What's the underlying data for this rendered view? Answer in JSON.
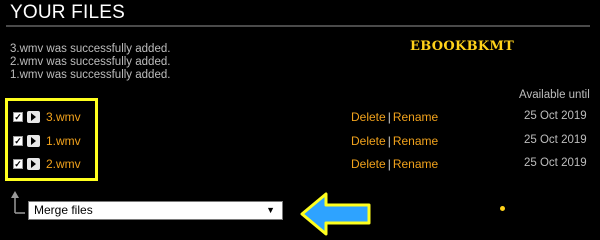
{
  "header": {
    "title": "YOUR FILES"
  },
  "messages": [
    "3.wmv was successfully added.",
    "2.wmv was successfully added.",
    "1.wmv was successfully added."
  ],
  "watermark": "EBOOKBKMT",
  "table": {
    "column_header": "Available until",
    "rows": [
      {
        "name": "3.wmv",
        "delete": "Delete",
        "separator": "|",
        "rename": "Rename",
        "expiry": "25 Oct 2019",
        "checked": true
      },
      {
        "name": "1.wmv",
        "delete": "Delete",
        "separator": "|",
        "rename": "Rename",
        "expiry": "25 Oct 2019",
        "checked": true
      },
      {
        "name": "2.wmv",
        "delete": "Delete",
        "separator": "|",
        "rename": "Rename",
        "expiry": "25 Oct 2019",
        "checked": true
      }
    ]
  },
  "action_select": {
    "selected": "Merge files",
    "caret": "▼"
  },
  "icons": {
    "checkbox": "checkbox-checked-icon",
    "play": "play-icon",
    "arrow_up": "arrow-up-icon",
    "callout": "arrow-left-icon"
  },
  "colors": {
    "background": "#000000",
    "link": "#f1a21c",
    "highlight": "#ffff1e",
    "callout_arrow": "#2ea3ff",
    "watermark": "#ffd21a"
  }
}
